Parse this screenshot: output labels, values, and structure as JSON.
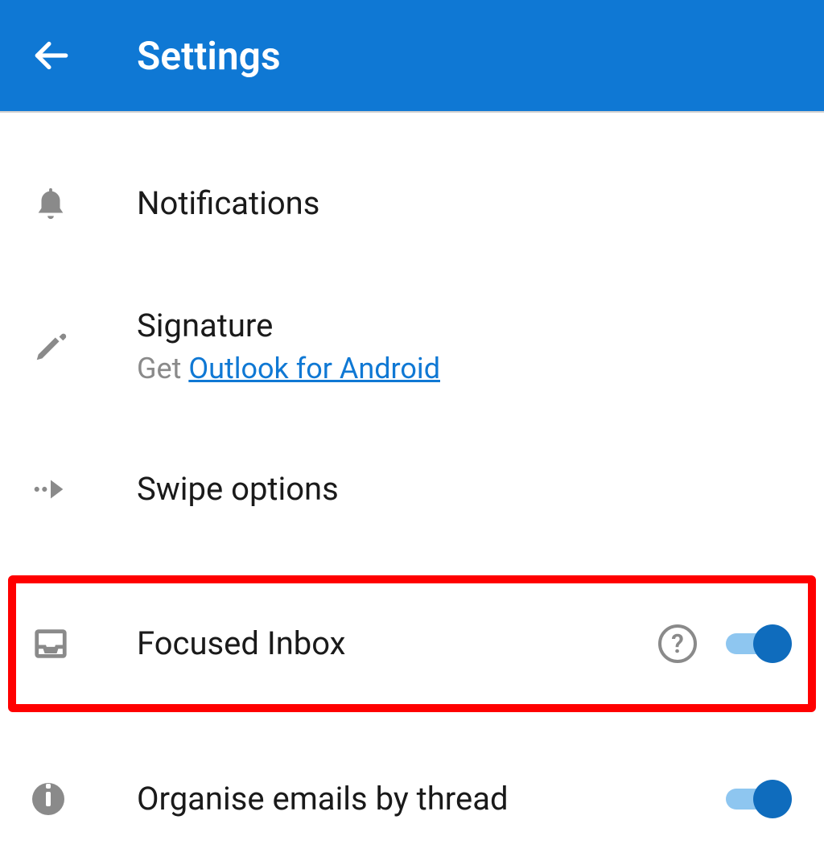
{
  "header": {
    "title": "Settings"
  },
  "items": {
    "notifications": {
      "title": "Notifications"
    },
    "signature": {
      "title": "Signature",
      "subtitle_prefix": "Get ",
      "subtitle_link": "Outlook for Android"
    },
    "swipe": {
      "title": "Swipe options"
    },
    "focused": {
      "title": "Focused Inbox",
      "toggle_on": true
    },
    "organise": {
      "title": "Organise emails by thread",
      "toggle_on": true
    }
  }
}
